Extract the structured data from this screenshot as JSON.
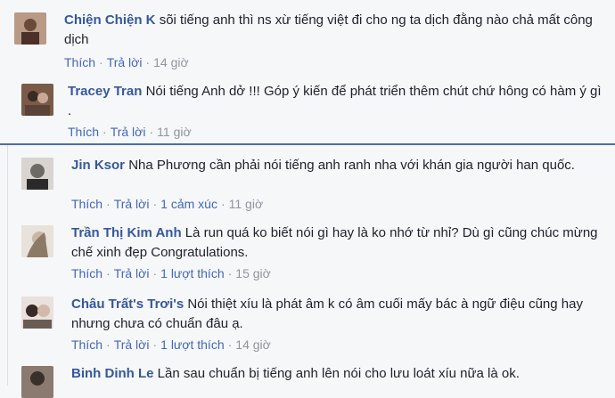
{
  "comments": [
    {
      "author": "Chiện Chiện K",
      "text": "sõi tiếng anh thì ns xừ tiếng việt đi cho ng ta dịch đằng nào chả mất công dịch",
      "like": "Thích",
      "reply": "Trả lời",
      "reactions": "",
      "time": "14 giờ",
      "avatar_color": "#b89a86"
    },
    {
      "author": "Tracey Tran",
      "text": "Nói tiếng Anh dở !!! Góp ý kiến để phát triển thêm chút chứ hông có hàm ý gì .",
      "like": "Thích",
      "reply": "Trả lời",
      "reactions": "",
      "time": "11 giờ",
      "avatar_color": "#7a5a48"
    },
    {
      "author": "Jin Ksor",
      "text": "Nha Phương cần phải nói tiếng anh ranh nha với khán gia người han quốc.",
      "like": "Thích",
      "reply": "Trả lời",
      "reactions": "1 cảm xúc",
      "time": "11 giờ",
      "avatar_color": "#6d6a66"
    },
    {
      "author": "Trần Thị Kim Anh",
      "text": "Là run quá ko biết nói gì hay là ko nhớ từ nhỉ? Dù gì cũng chúc mừng chế xinh đẹp Congratulations.",
      "like": "Thích",
      "reply": "Trả lời",
      "reactions": "1 lượt thích",
      "time": "15 giờ",
      "avatar_color": "#c7b7a3"
    },
    {
      "author": "Châu Trất's Trơi's",
      "text": "Nói thiệt xíu là phát âm k có âm cuối mấy bác à ngữ điệu cũng hay nhưng chưa có chuẩn đâu ạ.",
      "like": "Thích",
      "reply": "Trả lời",
      "reactions": "1 lượt thích",
      "time": "14 giờ",
      "avatar_color": "#d2b9a9"
    },
    {
      "author": "Binh Dinh Le",
      "text": "Lần sau chuẩn bị tiếng anh lên nói cho lưu loát xíu nữa là ok.",
      "like": "",
      "reply": "",
      "reactions": "",
      "time": "",
      "avatar_color": "#8a7a70"
    }
  ]
}
